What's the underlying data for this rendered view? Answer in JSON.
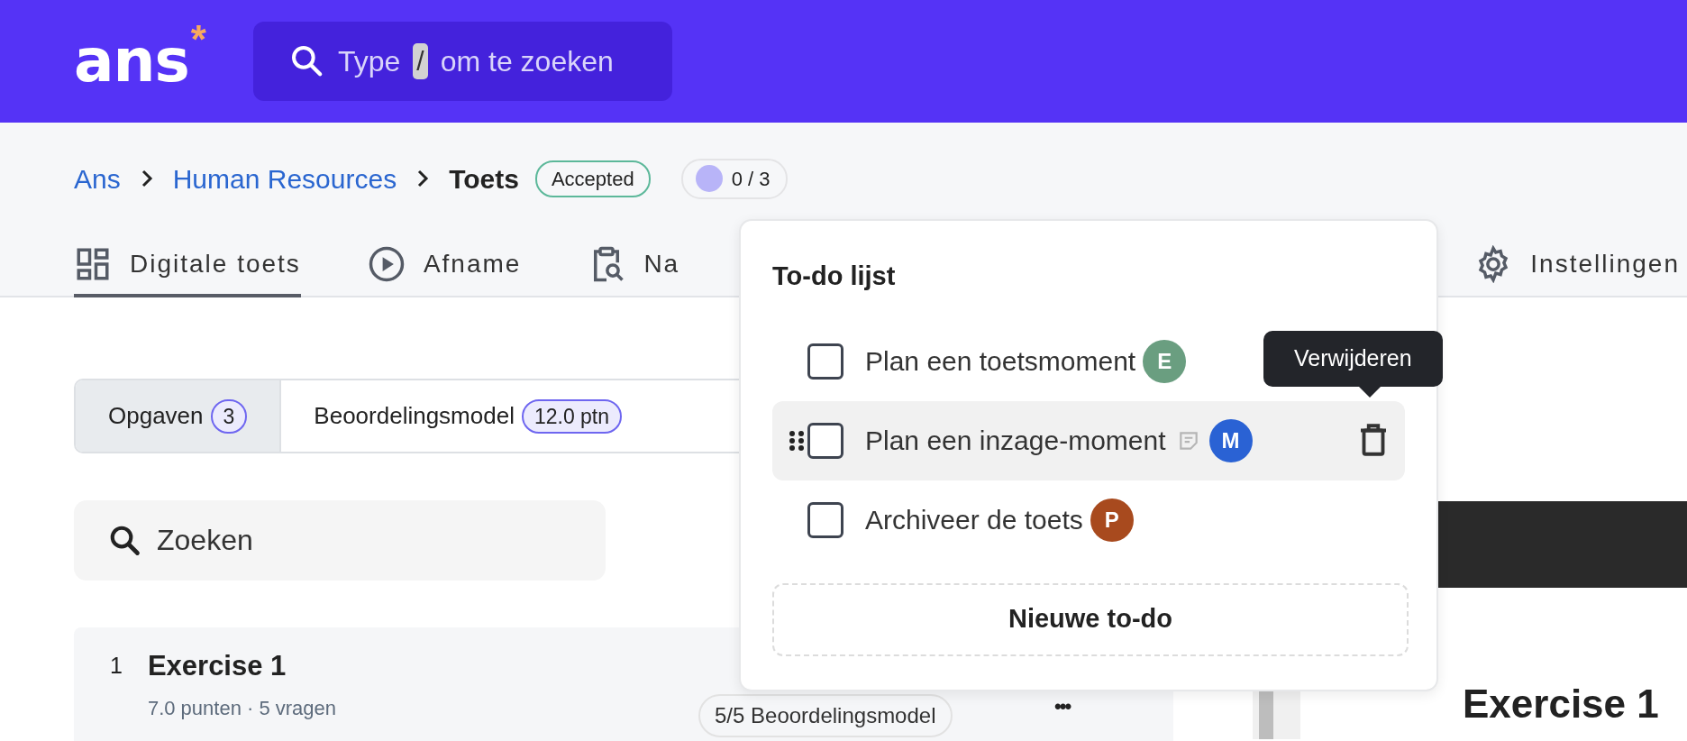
{
  "header": {
    "logo": "ans",
    "logo_mark": "*",
    "search": {
      "text_before": "Type",
      "key": "/",
      "text_after": "om te zoeken"
    }
  },
  "breadcrumb": {
    "links": [
      "Ans",
      "Human Resources"
    ],
    "current": "Toets",
    "status": "Accepted",
    "progress": "0 / 3"
  },
  "tabs": [
    {
      "label": "Digitale toets",
      "selected": true
    },
    {
      "label": "Afname",
      "selected": false
    },
    {
      "label": "Na",
      "selected": false
    },
    {
      "label": "Instellingen",
      "selected": false
    }
  ],
  "segments": [
    {
      "label": "Opgaven",
      "count": "3",
      "selected": true
    },
    {
      "label": "Beoordelingsmodel",
      "count": "12.0 ptn",
      "selected": false
    }
  ],
  "search": {
    "placeholder": "Zoeken"
  },
  "exercise": {
    "number": "1",
    "title": "Exercise 1",
    "meta": "7.0 punten · 5 vragen",
    "model": "5/5 Beoordelingsmodel",
    "menu": "•••"
  },
  "preview": {
    "title": "Exercise 1"
  },
  "todo": {
    "title": "To-do lijst",
    "items": [
      {
        "label": "Plan een toetsmoment",
        "avatar": "E",
        "color": "#6a9e80",
        "checked": false,
        "hovered": false,
        "has_note": false
      },
      {
        "label": "Plan een inzage-moment",
        "avatar": "M",
        "color": "#2a62d4",
        "checked": false,
        "hovered": true,
        "has_note": true
      },
      {
        "label": "Archiveer de toets",
        "avatar": "P",
        "color": "#a84a1e",
        "checked": false,
        "hovered": false,
        "has_note": false
      }
    ],
    "tooltip": "Verwijderen",
    "new_button": "Nieuwe to-do"
  }
}
